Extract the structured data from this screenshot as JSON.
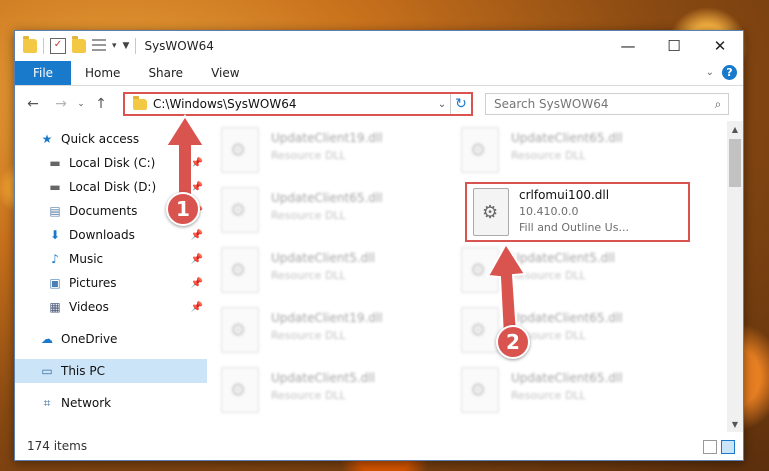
{
  "window": {
    "title": "SysWOW64"
  },
  "ribbon": {
    "tabs": [
      {
        "label": "File"
      },
      {
        "label": "Home"
      },
      {
        "label": "Share"
      },
      {
        "label": "View"
      }
    ]
  },
  "navigation": {
    "address": "C:\\Windows\\SysWOW64",
    "search_placeholder": "Search SysWOW64"
  },
  "sidebar": {
    "items": [
      {
        "label": "Quick access",
        "icon": "star-icon"
      },
      {
        "label": "Local Disk (C:)",
        "icon": "drive-icon",
        "pinned": true
      },
      {
        "label": "Local Disk (D:)",
        "icon": "drive-icon",
        "pinned": true
      },
      {
        "label": "Documents",
        "icon": "documents-icon",
        "pinned": true
      },
      {
        "label": "Downloads",
        "icon": "download-icon",
        "pinned": true
      },
      {
        "label": "Music",
        "icon": "music-icon",
        "pinned": true
      },
      {
        "label": "Pictures",
        "icon": "pictures-icon",
        "pinned": true
      },
      {
        "label": "Videos",
        "icon": "videos-icon",
        "pinned": true
      },
      {
        "label": "OneDrive",
        "icon": "cloud-icon"
      },
      {
        "label": "This PC",
        "icon": "computer-icon",
        "selected": true
      },
      {
        "label": "Network",
        "icon": "network-icon"
      }
    ]
  },
  "files": {
    "background": [
      {
        "name": "UpdateClient19.dll",
        "desc": "Resource DLL"
      },
      {
        "name": "UpdateClient65.dll",
        "desc": "Resource DLL"
      },
      {
        "name": "UpdateClient65.dll",
        "desc": "Resource DLL"
      },
      {
        "name": "",
        "desc": ""
      },
      {
        "name": "UpdateClient5.dll",
        "desc": "Resource DLL"
      },
      {
        "name": "UpdateClient5.dll",
        "desc": "Resource DLL"
      },
      {
        "name": "UpdateClient19.dll",
        "desc": "Resource DLL"
      },
      {
        "name": "UpdateClient65.dll",
        "desc": "Resource DLL"
      },
      {
        "name": "UpdateClient5.dll",
        "desc": "Resource DLL"
      },
      {
        "name": "UpdateClient65.dll",
        "desc": "Resource DLL"
      }
    ],
    "highlighted": {
      "name": "crlfomui100.dll",
      "version": "10.410.0.0",
      "desc": "Fill and Outline Us..."
    }
  },
  "status": {
    "item_count": "174 items"
  },
  "callouts": [
    {
      "label": "1"
    },
    {
      "label": "2"
    }
  ],
  "colors": {
    "accent": "#1979ca",
    "highlight": "#d9534f",
    "selected_bg": "#cce4f7"
  }
}
